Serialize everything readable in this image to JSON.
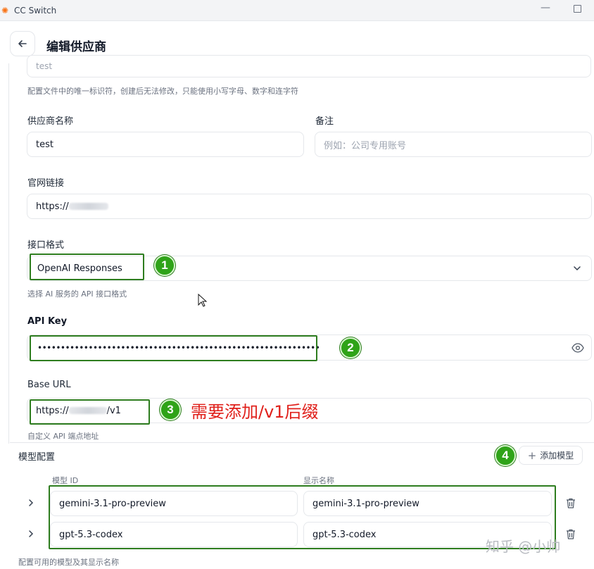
{
  "window": {
    "title": "CC Switch",
    "logo_icon": "✺"
  },
  "header": {
    "title": "编辑供应商"
  },
  "fields": {
    "provider_id": {
      "value": "test",
      "hint": "配置文件中的唯一标识符，创建后无法修改，只能使用小写字母、数字和连字符"
    },
    "provider_name": {
      "label": "供应商名称",
      "value": "test"
    },
    "notes": {
      "label": "备注",
      "placeholder": "例如：公司专用账号"
    },
    "website": {
      "label": "官网链接",
      "value_prefix": "https://"
    },
    "api_format": {
      "label": "接口格式",
      "value": "OpenAI Responses",
      "hint": "选择 AI 服务的 API 接口格式"
    },
    "api_key": {
      "label": "API Key",
      "value": "•••••••••••••••••••••••••••••••••••••••••••••••••••••••••••••"
    },
    "base_url": {
      "label": "Base URL",
      "value_prefix": "https://",
      "value_suffix": "/v1",
      "hint": "自定义 API 端点地址"
    }
  },
  "annotations": {
    "badges": [
      "1",
      "2",
      "3",
      "4"
    ],
    "base_url_note": "需要添加/v1后缀",
    "accent_green": "#2e7d1f",
    "annotation_red": "#e0201b"
  },
  "models": {
    "title": "模型配置",
    "add_button": "添加模型",
    "col_id": "模型 ID",
    "col_name": "显示名称",
    "rows": [
      {
        "id": "gemini-3.1-pro-preview",
        "name": "gemini-3.1-pro-preview"
      },
      {
        "id": "gpt-5.3-codex",
        "name": "gpt-5.3-codex"
      }
    ],
    "hint": "配置可用的模型及其显示名称"
  },
  "watermark": "知乎 @小帅"
}
